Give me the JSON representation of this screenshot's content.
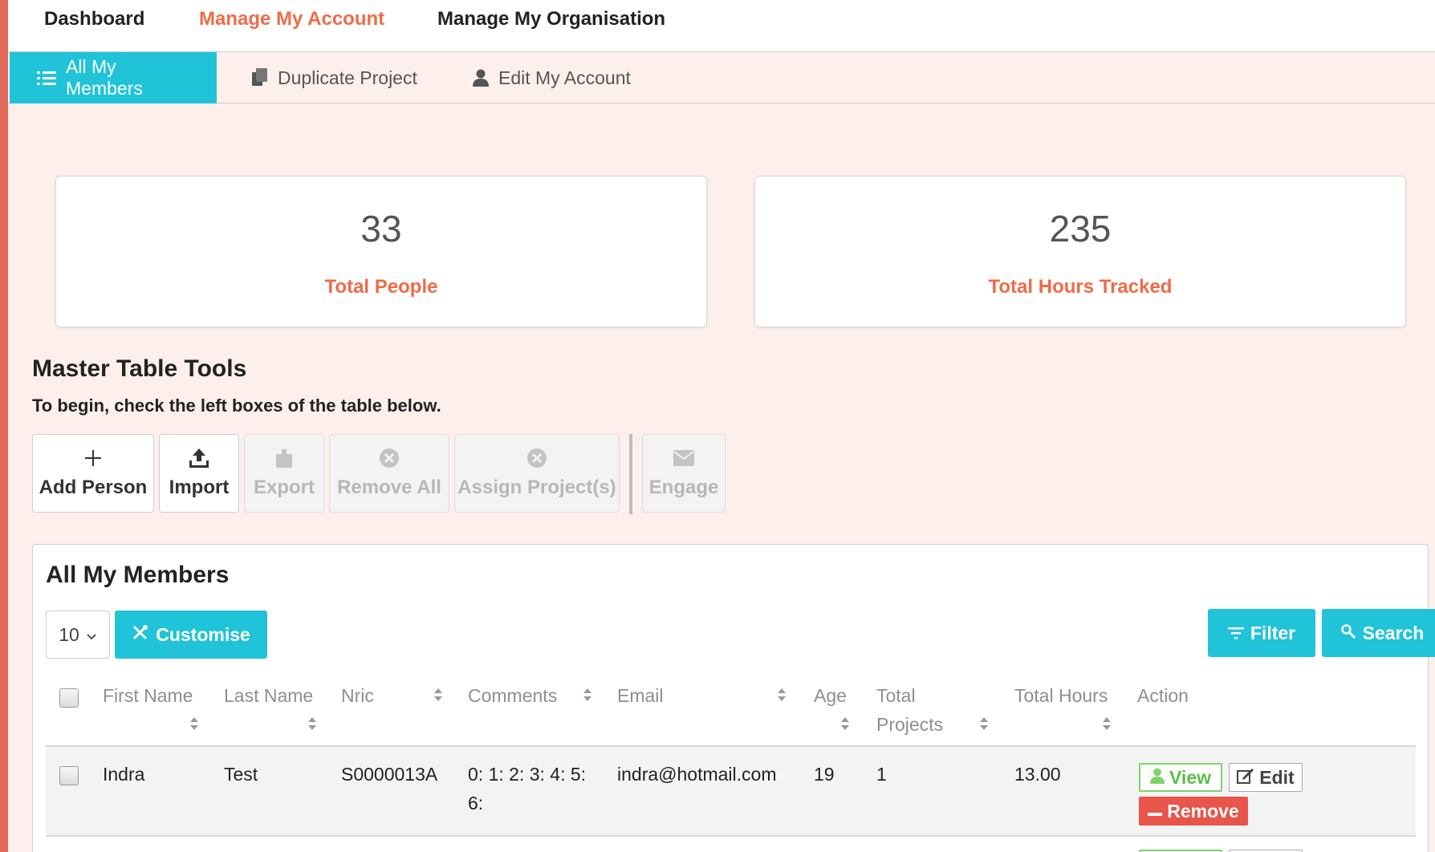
{
  "topnav": {
    "items": [
      {
        "label": "Dashboard",
        "active": false
      },
      {
        "label": "Manage My Account",
        "active": true
      },
      {
        "label": "Manage My Organisation",
        "active": false
      }
    ]
  },
  "subnav": {
    "tabs": [
      {
        "label": "All My Members",
        "icon": "list-icon",
        "active": true
      },
      {
        "label": "Duplicate Project",
        "icon": "copy-icon",
        "active": false
      },
      {
        "label": "Edit My Account",
        "icon": "user-icon",
        "active": false
      }
    ]
  },
  "stats": {
    "total_people": {
      "value": "33",
      "label": "Total People"
    },
    "total_hours": {
      "value": "235",
      "label": "Total Hours Tracked"
    }
  },
  "tools": {
    "title": "Master Table Tools",
    "subtitle": "To begin, check the left boxes of the table below.",
    "buttons": {
      "add_person": {
        "label": "Add Person",
        "icon": "plus-icon",
        "enabled": true
      },
      "import": {
        "label": "Import",
        "icon": "upload-icon",
        "enabled": true
      },
      "export": {
        "label": "Export",
        "icon": "export-icon",
        "enabled": false
      },
      "remove_all": {
        "label": "Remove All",
        "icon": "close-circle-icon",
        "enabled": false
      },
      "assign_projects": {
        "label": "Assign Project(s)",
        "icon": "close-circle-icon",
        "enabled": false
      },
      "engage": {
        "label": "Engage",
        "icon": "envelope-icon",
        "enabled": false
      }
    }
  },
  "members": {
    "title": "All My Members",
    "page_size": "10",
    "customise_label": "Customise",
    "filter_label": "Filter",
    "search_label": "Search",
    "columns": {
      "first_name": "First Name",
      "last_name": "Last Name",
      "nric": "Nric",
      "comments": "Comments",
      "email": "Email",
      "age": "Age",
      "total_projects": "Total Projects",
      "total_hours": "Total Hours",
      "action": "Action"
    },
    "rows": [
      {
        "first_name": "Indra",
        "last_name": "Test",
        "nric": "S0000013A",
        "comments": "0: 1: 2: 3: 4: 5: 6:",
        "email": "indra@hotmail.com",
        "age": "19",
        "total_projects": "1",
        "total_hours": "13.00",
        "actions": {
          "view": "View",
          "edit": "Edit",
          "remove": "Remove"
        }
      }
    ]
  },
  "colors": {
    "accent_orange": "#ef6b47",
    "cyan": "#21c3d8",
    "view_green": "#5cbf48",
    "remove_red": "#e8554a",
    "page_bg": "#fdf0ec"
  }
}
